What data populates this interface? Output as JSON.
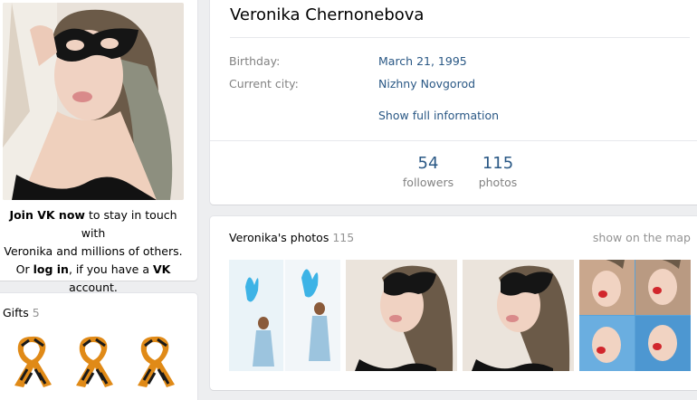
{
  "profile": {
    "name": "Veronika Chernonebova",
    "birthday_label": "Birthday:",
    "birthday_value": "March 21, 1995",
    "city_label": "Current city:",
    "city_value": "Nizhny Novgorod",
    "show_full": "Show full information"
  },
  "counters": [
    {
      "value": "54",
      "label": "followers"
    },
    {
      "value": "115",
      "label": "photos"
    }
  ],
  "join": {
    "join_vk_now": "Join VK now",
    "line1_rest": " to stay in touch with",
    "line2": "Veronika and millions of others.",
    "or": "Or ",
    "log_in": "log in",
    "if_you_have": ", if you have a ",
    "vk": "VK",
    "account": " account."
  },
  "gifts": {
    "title": "Gifts",
    "count": "5",
    "items": [
      "ribbon-icon",
      "ribbon-icon",
      "ribbon-icon"
    ]
  },
  "photos": {
    "title": "Veronika's photos",
    "count": "115",
    "show_on_map": "show on the map"
  },
  "colors": {
    "link": "#2a5885",
    "muted": "#828282",
    "page_bg": "#edeef0"
  }
}
